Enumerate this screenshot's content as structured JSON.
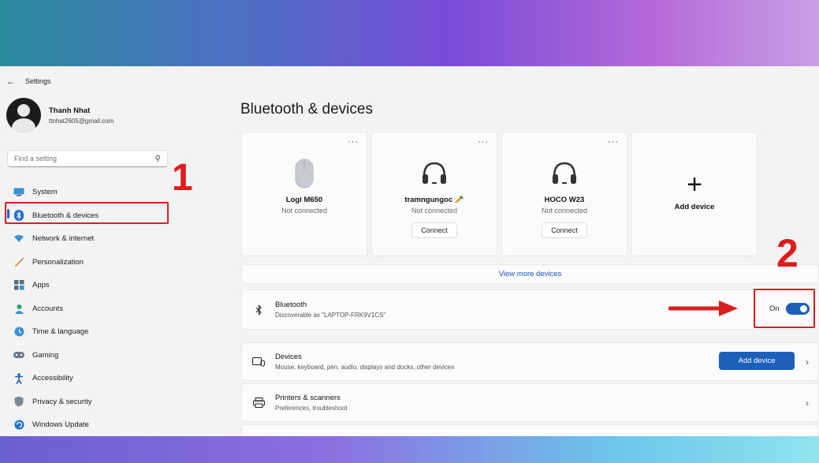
{
  "window": {
    "title": "Settings"
  },
  "profile": {
    "name": "Thanh Nhat",
    "email": "ttnhat2605@gmail.com"
  },
  "search": {
    "placeholder": "Find a setting"
  },
  "annotations": {
    "label_1": "1",
    "label_2": "2",
    "highlight_color": "#d81e1e"
  },
  "sidebar": {
    "items": [
      {
        "label": "System",
        "icon": "system-icon"
      },
      {
        "label": "Bluetooth & devices",
        "icon": "bluetooth-icon",
        "active": true
      },
      {
        "label": "Network & internet",
        "icon": "wifi-icon"
      },
      {
        "label": "Personalization",
        "icon": "brush-icon"
      },
      {
        "label": "Apps",
        "icon": "apps-icon"
      },
      {
        "label": "Accounts",
        "icon": "person-icon"
      },
      {
        "label": "Time & language",
        "icon": "globe-clock-icon"
      },
      {
        "label": "Gaming",
        "icon": "gamepad-icon"
      },
      {
        "label": "Accessibility",
        "icon": "accessibility-icon"
      },
      {
        "label": "Privacy & security",
        "icon": "shield-icon"
      },
      {
        "label": "Windows Update",
        "icon": "update-icon"
      }
    ]
  },
  "main": {
    "title": "Bluetooth & devices",
    "devices": [
      {
        "name": "Logi M650",
        "status": "Not connected",
        "icon": "mouse-icon",
        "connect_label": ""
      },
      {
        "name": "tramngungoc 🥕",
        "status": "Not connected",
        "icon": "headphones-icon",
        "connect_label": "Connect"
      },
      {
        "name": "HOCO W23",
        "status": "Not connected",
        "icon": "headphones-icon",
        "connect_label": "Connect"
      }
    ],
    "add_device_card_label": "Add device",
    "more_glyph": "···",
    "view_more": "View more devices",
    "bluetooth": {
      "title": "Bluetooth",
      "subtitle": "Discoverable as \"LAPTOP-FRK9V1CS\"",
      "toggle_label": "On",
      "enabled": true
    },
    "devices_row": {
      "title": "Devices",
      "subtitle": "Mouse, keyboard, pen, audio, displays and docks, other devices",
      "button_label": "Add device"
    },
    "printers_row": {
      "title": "Printers & scanners",
      "subtitle": "Preferences, troubleshoot"
    }
  },
  "colors": {
    "accent": "#1c5fb8",
    "link": "#1c55b8"
  }
}
